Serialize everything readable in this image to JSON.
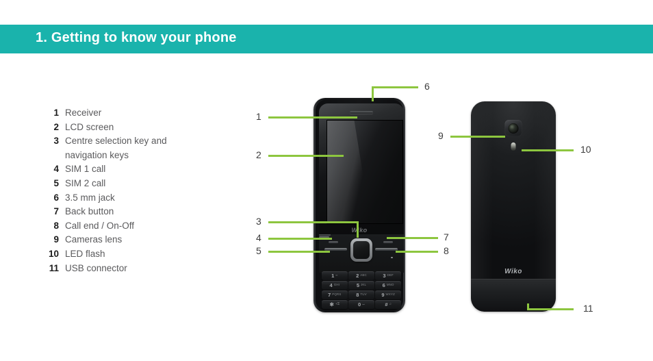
{
  "header": {
    "title": "1. Getting to know your phone",
    "bar_color": "#1ab3ac",
    "text_color": "#ffffff"
  },
  "theme": {
    "callout_line_color": "#8dc63f",
    "legend_number_color": "#1c1c1c",
    "legend_label_color": "#5a5a5c",
    "background": "#ffffff"
  },
  "legend": {
    "items": [
      {
        "num": "1",
        "label": "Receiver"
      },
      {
        "num": "2",
        "label": "LCD screen"
      },
      {
        "num": "3",
        "label": "Centre selection key and\nnavigation keys"
      },
      {
        "num": "4",
        "label": "SIM 1 call"
      },
      {
        "num": "5",
        "label": "SIM 2 call"
      },
      {
        "num": "6",
        "label": "3.5 mm jack"
      },
      {
        "num": "7",
        "label": "Back button"
      },
      {
        "num": "8",
        "label": "Call end / On-Off"
      },
      {
        "num": "9",
        "label": "Cameras lens"
      },
      {
        "num": "10",
        "label": "LED flash"
      },
      {
        "num": "11",
        "label": "USB connector"
      }
    ]
  },
  "callouts": {
    "front": [
      {
        "id": "callout-1",
        "num": "1"
      },
      {
        "id": "callout-2",
        "num": "2"
      },
      {
        "id": "callout-3",
        "num": "3"
      },
      {
        "id": "callout-4",
        "num": "4"
      },
      {
        "id": "callout-5",
        "num": "5"
      },
      {
        "id": "callout-6",
        "num": "6"
      },
      {
        "id": "callout-7",
        "num": "7"
      },
      {
        "id": "callout-8",
        "num": "8"
      }
    ],
    "back": [
      {
        "id": "callout-9",
        "num": "9"
      },
      {
        "id": "callout-10",
        "num": "10"
      },
      {
        "id": "callout-11",
        "num": "11"
      }
    ]
  },
  "phone_front": {
    "brand_logo": "Wiko",
    "keypad": [
      {
        "digit": "1",
        "sub": "∞"
      },
      {
        "digit": "2",
        "sub": "ABC"
      },
      {
        "digit": "3",
        "sub": "DEF"
      },
      {
        "digit": "4",
        "sub": "GHI"
      },
      {
        "digit": "5",
        "sub": "JKL"
      },
      {
        "digit": "6",
        "sub": "MNO"
      },
      {
        "digit": "7",
        "sub": "PQRS"
      },
      {
        "digit": "8",
        "sub": "TUV"
      },
      {
        "digit": "9",
        "sub": "WXYZ"
      },
      {
        "digit": "✻",
        "sub": "+⚿"
      },
      {
        "digit": "0",
        "sub": "⌴"
      },
      {
        "digit": "#",
        "sub": "♫"
      }
    ]
  },
  "phone_back": {
    "brand_logo": "Wiko"
  }
}
